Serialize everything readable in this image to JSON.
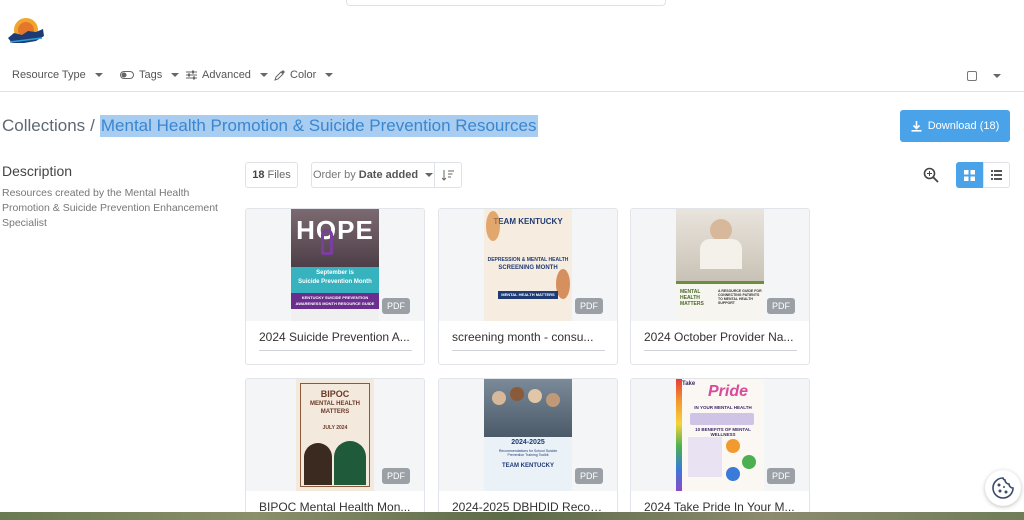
{
  "filters": {
    "resource_type": "Resource Type",
    "tags": "Tags",
    "advanced": "Advanced",
    "color": "Color"
  },
  "breadcrumb": {
    "root": "Collections",
    "separator": "/",
    "current": "Mental Health Promotion & Suicide Prevention Resources"
  },
  "download": {
    "label": "Download (18)"
  },
  "description": {
    "title": "Description",
    "text": "Resources created by the Mental Health Promotion & Suicide Prevention Enhancement Specialist"
  },
  "toolbar": {
    "files_count": "18",
    "files_label": "Files",
    "order_prefix": "Order by",
    "order_value": "Date added"
  },
  "cards": [
    {
      "title": "2024 Suicide Prevention A...",
      "type": "PDF",
      "poster": {
        "big": "HOPE",
        "line1": "September is",
        "line2": "Suicide Prevention Month",
        "line3": "KENTUCKY SUICIDE PREVENTION",
        "line4": "AWARENESS MONTH RESOURCE GUIDE"
      }
    },
    {
      "title": "screening month - consu...",
      "type": "PDF",
      "poster": {
        "brand": "TEAM KENTUCKY",
        "line1": "DEPRESSION & MENTAL HEALTH",
        "line2": "SCREENING MONTH",
        "line3": "MENTAL HEALTH MATTERS"
      }
    },
    {
      "title": "2024 October Provider Na...",
      "type": "PDF",
      "poster": {
        "line1": "MENTAL HEALTH MATTERS",
        "line2": "A RESOURCE GUIDE FOR CONNECTING PATIENTS TO MENTAL HEALTH SUPPORT"
      }
    },
    {
      "title": "BIPOC Mental Health Mon...",
      "type": "PDF",
      "poster": {
        "line1": "BIPOC",
        "line2": "MENTAL HEALTH",
        "line3": "MATTERS",
        "line4": "JULY 2024"
      }
    },
    {
      "title": "2024-2025 DBHDID Recom...",
      "type": "PDF",
      "poster": {
        "line1": "2024-2025",
        "line2": "Recommendations for School Suicide Prevention Training Toolkit",
        "brand": "TEAM KENTUCKY"
      }
    },
    {
      "title": "2024 Take Pride In Your M...",
      "type": "PDF",
      "poster": {
        "line1": "Take",
        "line2": "Pride",
        "line3": "IN YOUR MENTAL HEALTH",
        "line4": "10 BENEFITS OF MENTAL WELLNESS"
      }
    }
  ]
}
